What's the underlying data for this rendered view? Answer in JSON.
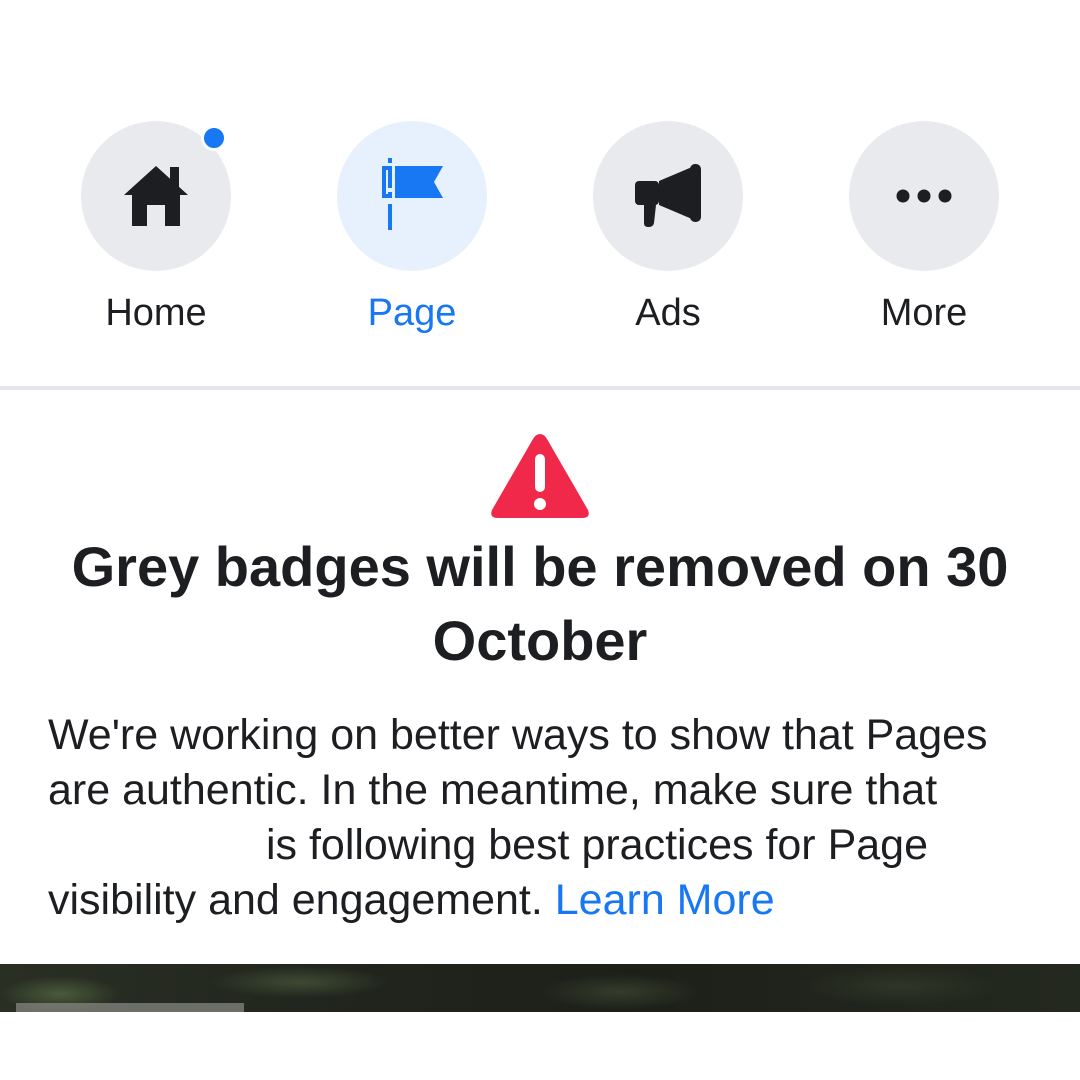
{
  "nav": {
    "items": [
      {
        "label": "Home",
        "icon": "home-icon",
        "has_notification": true
      },
      {
        "label": "Page",
        "icon": "flag-icon",
        "active": true
      },
      {
        "label": "Ads",
        "icon": "megaphone-icon"
      },
      {
        "label": "More",
        "icon": "more-dots-icon"
      }
    ]
  },
  "notice": {
    "icon": "warning-icon",
    "title": "Grey badges will be removed on 30 October",
    "body_part1": "We're working on better ways to show that Pages are authentic. In the meantime, make sure that",
    "body_part2": "is following best practices for Page visibility and engagement.",
    "link_label": "Learn More"
  },
  "colors": {
    "accent": "#1877f2",
    "warning": "#f02849",
    "text": "#1c1e21",
    "icon_bg": "#e9eaee",
    "active_icon_bg": "#e7f1fd"
  }
}
